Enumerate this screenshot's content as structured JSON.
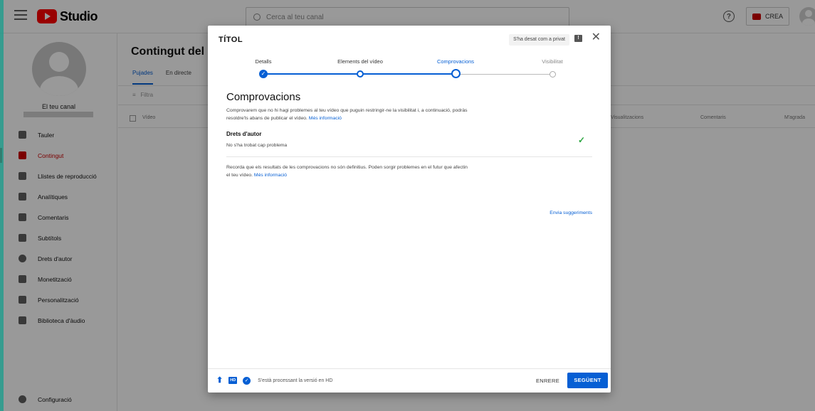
{
  "topbar": {
    "logo_text": "Studio",
    "search_placeholder": "Cerca al teu canal",
    "help_glyph": "?",
    "create_label": "CREA"
  },
  "sidebar": {
    "channel_label": "El teu canal",
    "items": [
      {
        "label": "Tauler",
        "icon": "dashboard-icon"
      },
      {
        "label": "Contingut",
        "icon": "content-icon",
        "active": true
      },
      {
        "label": "Llistes de reproducció",
        "icon": "playlist-icon"
      },
      {
        "label": "Analítiques",
        "icon": "analytics-icon"
      },
      {
        "label": "Comentaris",
        "icon": "comments-icon"
      },
      {
        "label": "Subtítols",
        "icon": "subtitles-icon"
      },
      {
        "label": "Drets d'autor",
        "icon": "copyright-icon"
      },
      {
        "label": "Monetització",
        "icon": "monetization-icon"
      },
      {
        "label": "Personalització",
        "icon": "customization-icon"
      },
      {
        "label": "Biblioteca d'àudio",
        "icon": "audio-library-icon"
      }
    ],
    "settings_label": "Configuració"
  },
  "content": {
    "title": "Contingut del ca",
    "tabs": [
      "Pujades",
      "En directe"
    ],
    "filter_label": "Filtra",
    "columns": {
      "video": "Vídeo",
      "views": "Visualitzacions",
      "comments": "Comentaris",
      "likes": "M'agrada"
    }
  },
  "dialog": {
    "title": "TÍTOL",
    "saved_badge": "S'ha desat com a privat",
    "feedback_glyph": "!",
    "close_glyph": "✕",
    "steps": [
      {
        "label": "Detalls",
        "state": "done"
      },
      {
        "label": "Elements del vídeo",
        "state": "done"
      },
      {
        "label": "Comprovacions",
        "state": "current"
      },
      {
        "label": "Visibilitat",
        "state": "future"
      }
    ],
    "check_glyph": "✓",
    "heading": "Comprovacions",
    "intro": "Comprovarem que no hi hagi problemes al teu vídeo que puguin restringir-ne la visibilitat i, a continuació, podràs resoldre'ls abans de publicar el vídeo.",
    "more_info": "Més informació",
    "copyright_title": "Drets d'autor",
    "copyright_status": "No s'ha trobat cap problema",
    "copyright_check_glyph": "✓",
    "reminder": "Recorda que els resultats de les comprovacions no són definitius. Poden sorgir problemes en el futur que afectin el teu vídeo.",
    "more_info_2": "Més informació",
    "send_feedback": "Envia suggeriments",
    "footer": {
      "upload_glyph": "⬆",
      "hd_label": "HD",
      "processed_glyph": "✓",
      "status": "S'està processant la versió en HD",
      "back_label": "ENRERE",
      "next_label": "SEGÜENT"
    }
  }
}
